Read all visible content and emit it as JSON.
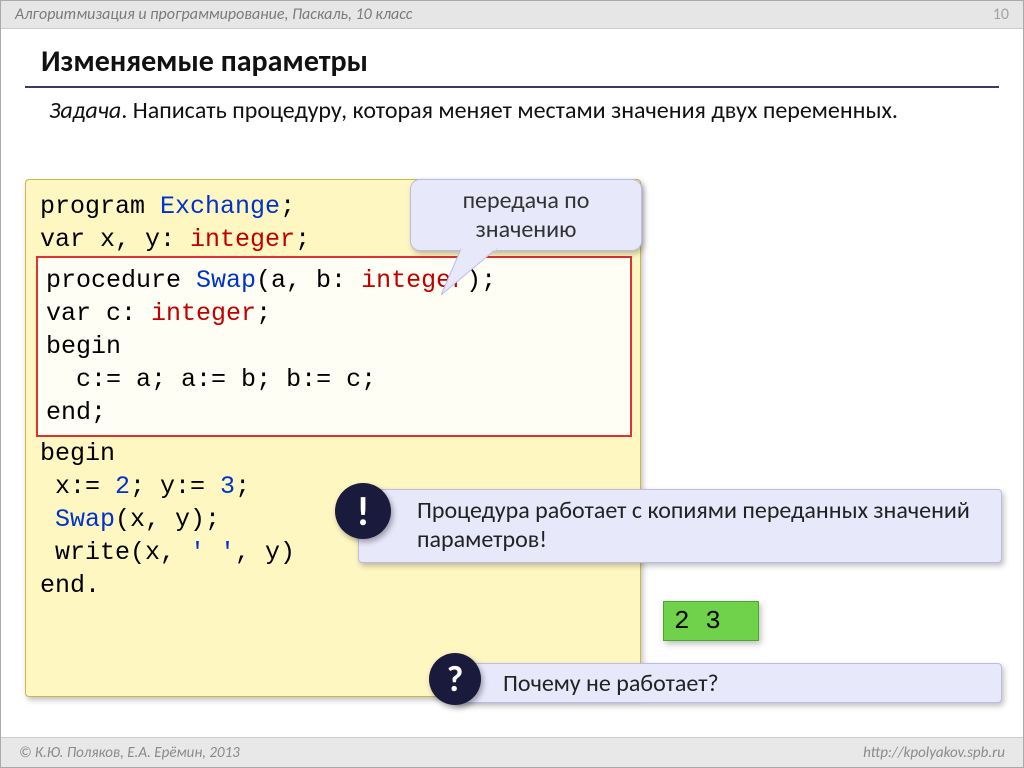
{
  "header": {
    "course": "Алгоритмизация и программирование, Паскаль, 10 класс",
    "page": "10"
  },
  "title": "Изменяемые параметры",
  "task": {
    "label": "Задача",
    "text": ". Написать процедуру, которая меняет местами значения двух переменных."
  },
  "callout": "передача по значению",
  "code": {
    "l1a": "program ",
    "l1b": "Exchange",
    "l1c": ";",
    "l2a": "var x, y: ",
    "l2b": "integer",
    "l2c": ";",
    "l3a": "procedure ",
    "l3b": "Swap",
    "l3c": "(a, b: ",
    "l3d": "integer",
    "l3e": ");",
    "l4a": "var c: ",
    "l4b": "integer",
    "l4c": ";",
    "l5": "begin",
    "l6a": "  c:= ",
    "l6b": "a",
    "l6c": "; a:= ",
    "l6d": "b",
    "l6e": "; b:= ",
    "l6f": "c",
    "l6g": ";",
    "l7": "end;",
    "l8": "begin",
    "l9a": " x:= ",
    "l9b": "2",
    "l9c": "; y:= ",
    "l9d": "3",
    "l9e": ";",
    "l10a": " ",
    "l10b": "Swap",
    "l10c": "(x, y);",
    "l11a": " write(x, ",
    "l11b": "' '",
    "l11c": ", y)",
    "l12": "end."
  },
  "note1": {
    "badge": "!",
    "text": "Процедура работает с копиями переданных значений параметров!"
  },
  "result": "2 3",
  "note2": {
    "badge": "?",
    "text": "Почему не работает?"
  },
  "footer": {
    "copyright": "© К.Ю. Поляков, Е.А. Ерёмин, 2013",
    "url": "http://kpolyakov.spb.ru"
  }
}
